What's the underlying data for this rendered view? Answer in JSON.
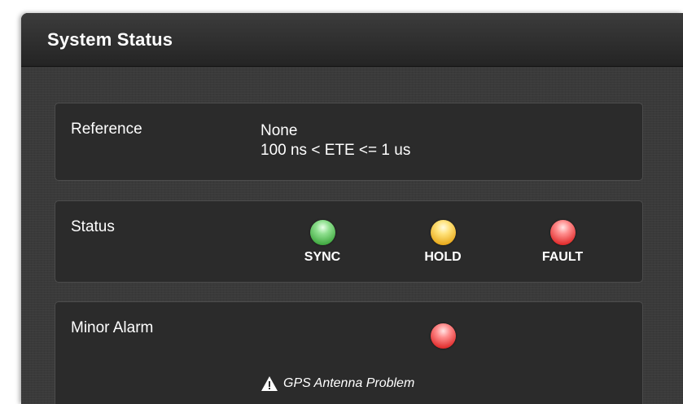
{
  "header": {
    "title": "System Status"
  },
  "reference": {
    "label": "Reference",
    "value_line1": "None",
    "value_line2": "100 ns < ETE <= 1 us"
  },
  "status": {
    "label": "Status",
    "indicators": [
      {
        "label": "SYNC",
        "color": "#5cc65c",
        "icon": "green-led-icon"
      },
      {
        "label": "HOLD",
        "color": "#f5c232",
        "icon": "yellow-led-icon"
      },
      {
        "label": "FAULT",
        "color": "#f04848",
        "icon": "red-led-icon"
      }
    ]
  },
  "minor_alarm": {
    "label": "Minor Alarm",
    "led_color": "#f04848",
    "message": "GPS Antenna Problem",
    "message_icon": "warning-icon"
  }
}
